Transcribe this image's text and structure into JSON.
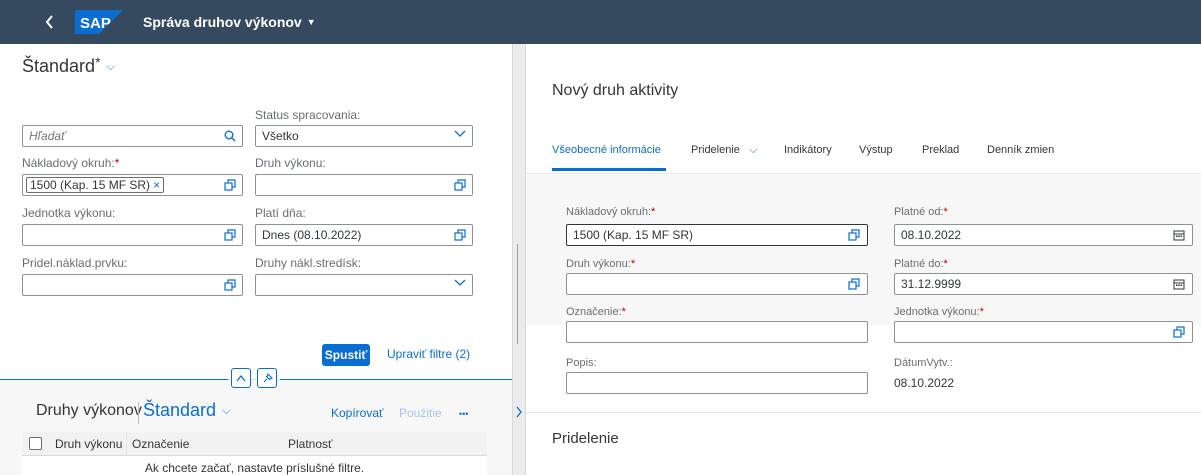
{
  "shell": {
    "back_icon": "chevron-left-icon",
    "logo_text": "SAP",
    "logo_color": "#0a6ed1",
    "app_title": "Správa druhov výkonov",
    "title_caret": "▼"
  },
  "filter_bar": {
    "variant_name": "Štandard",
    "variant_modified": "*",
    "variant_chevron": "⌵",
    "search": {
      "placeholder": "Hľadať",
      "icon": "search-icon"
    },
    "status": {
      "label": "Status spracovania:",
      "value": "Všetko"
    },
    "cost_area": {
      "label": "Nákladový okruh:",
      "required": "*",
      "token": "1500 (Kap. 15 MF SR)",
      "token_remove": "×"
    },
    "activity_type": {
      "label": "Druh výkonu:",
      "value": ""
    },
    "unit": {
      "label": "Jednotka výkonu:",
      "value": ""
    },
    "valid_on": {
      "label": "Platí dňa:",
      "value": "Dnes (08.10.2022)"
    },
    "element_assign": {
      "label": "Pridel.náklad.prvku:",
      "value": ""
    },
    "cc_types": {
      "label": "Druhy nákl.stredísk:",
      "value": ""
    },
    "go_button": "Spustiť",
    "adapt_link": "Upraviť filtre (2)"
  },
  "list": {
    "title": "Druhy výkonov",
    "variant": "Štandard",
    "copy_label": "Kopírovať",
    "use_label": "Použitie",
    "more_label": "•••",
    "columns": [
      "Druh výkonu",
      "Označenie",
      "Platnosť"
    ],
    "empty_text": "Ak chcete začať, nastavte príslušné filtre."
  },
  "detail": {
    "title": "Nový druh aktivity",
    "tabs": [
      {
        "label": "Všeobecné informácie"
      },
      {
        "label": "Pridelenie"
      },
      {
        "label": "Indikátory"
      },
      {
        "label": "Výstup"
      },
      {
        "label": "Preklad"
      },
      {
        "label": "Denník zmien"
      }
    ],
    "tab_chevron": "⌵",
    "fields": {
      "cost_area": {
        "label": "Nákladový okruh:",
        "value": "1500 (Kap. 15 MF SR)"
      },
      "valid_from": {
        "label": "Platné od:",
        "value": "08.10.2022"
      },
      "activity_type": {
        "label": "Druh výkonu:",
        "value": ""
      },
      "valid_to": {
        "label": "Platné do:",
        "value": "31.12.9999"
      },
      "designation": {
        "label": "Označenie:",
        "value": ""
      },
      "unit": {
        "label": "Jednotka výkonu:",
        "value": ""
      },
      "description": {
        "label": "Popis:",
        "value": ""
      },
      "created": {
        "label": "DátumVytv.:",
        "value": "08.10.2022"
      }
    },
    "required_mark": "*",
    "section_title": "Pridelenie"
  },
  "colors": {
    "shell": "#354a5f",
    "accent": "#0a6ed1",
    "required": "#bb0000"
  }
}
